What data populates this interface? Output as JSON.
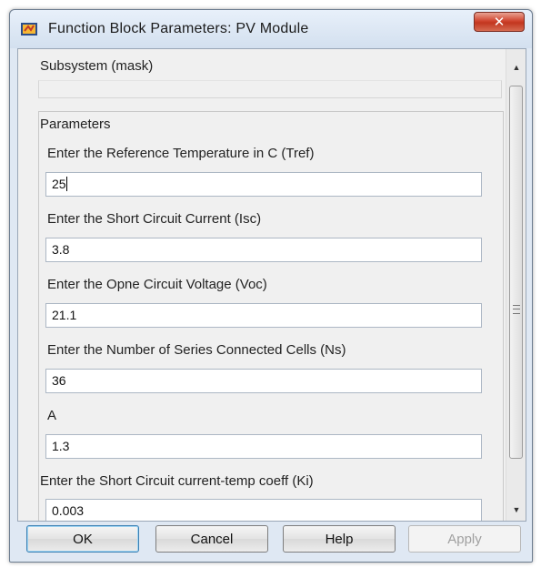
{
  "window": {
    "title": "Function Block Parameters: PV Module",
    "close_label": "✕"
  },
  "subsystem": {
    "label": "Subsystem (mask)",
    "description": ""
  },
  "parameters": {
    "group_label": "Parameters",
    "fields": [
      {
        "label": "Enter the Reference Temperature in C (Tref)",
        "value": "25"
      },
      {
        "label": "Enter the Short Circuit Current (Isc)",
        "value": "3.8"
      },
      {
        "label": "Enter the Opne Circuit Voltage (Voc)",
        "value": "21.1"
      },
      {
        "label": "Enter the Number of Series Connected Cells (Ns)",
        "value": "36"
      },
      {
        "label": "A",
        "value": "1.3"
      },
      {
        "label": "Enter the Short Circuit current-temp coeff (Ki)",
        "value": "0.003"
      }
    ]
  },
  "scrollbar": {
    "up_arrow": "▲",
    "down_arrow": "▼"
  },
  "buttons": {
    "ok": "OK",
    "cancel": "Cancel",
    "help": "Help",
    "apply": "Apply"
  }
}
